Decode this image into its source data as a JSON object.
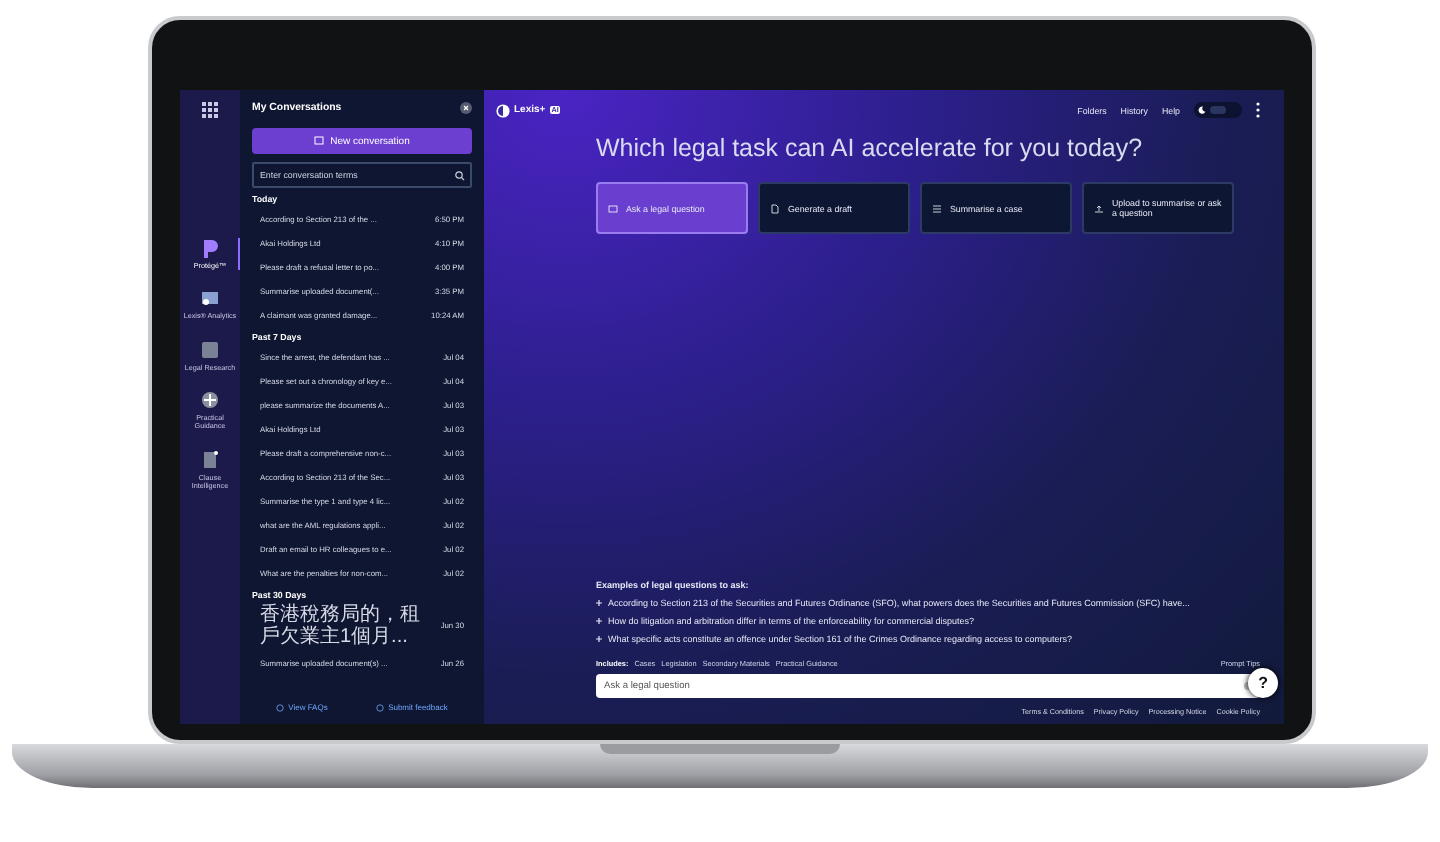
{
  "rail": [
    {
      "label": "Protégé™",
      "selected": true
    },
    {
      "label": "Lexis® Analytics",
      "selected": false
    },
    {
      "label": "Legal Research",
      "selected": false
    },
    {
      "label": "Practical Guidance",
      "selected": false
    },
    {
      "label": "Clause Intelligence",
      "selected": false
    }
  ],
  "conversations": {
    "title": "My Conversations",
    "new_button": "New conversation",
    "search_placeholder": "Enter conversation terms",
    "groups": [
      {
        "label": "Today",
        "items": [
          {
            "title": "According to Section 213 of the ...",
            "time": "6:50 PM"
          },
          {
            "title": "Akai Holdings Ltd",
            "time": "4:10 PM"
          },
          {
            "title": "Please draft a refusal letter to po...",
            "time": "4:00 PM"
          },
          {
            "title": "Summarise uploaded document(...",
            "time": "3:35 PM"
          },
          {
            "title": "A claimant was granted damage...",
            "time": "10:24 AM"
          }
        ]
      },
      {
        "label": "Past 7 Days",
        "items": [
          {
            "title": "Since the arrest, the defendant has ...",
            "time": "Jul 04"
          },
          {
            "title": "Please set out a chronology of key e...",
            "time": "Jul 04"
          },
          {
            "title": "please summarize the documents A...",
            "time": "Jul 03"
          },
          {
            "title": "Akai Holdings Ltd",
            "time": "Jul 03"
          },
          {
            "title": "Please draft a comprehensive non-c...",
            "time": "Jul 03"
          },
          {
            "title": "According to Section 213 of the Sec...",
            "time": "Jul 03"
          },
          {
            "title": "Summarise the type 1 and type 4 lic...",
            "time": "Jul 02"
          },
          {
            "title": "what are the AML regulations appli...",
            "time": "Jul 02"
          },
          {
            "title": "Draft an email to HR colleagues to e...",
            "time": "Jul 02"
          },
          {
            "title": "What are the penalties for non-com...",
            "time": "Jul 02"
          }
        ]
      },
      {
        "label": "Past 30 Days",
        "items": [
          {
            "title": "香港稅務局的，租戶欠業主1個月...",
            "time": "Jun 30"
          },
          {
            "title": "Summarise uploaded document(s) ...",
            "time": "Jun 26"
          }
        ]
      }
    ],
    "footer": [
      "View FAQs",
      "Submit feedback"
    ]
  },
  "main": {
    "logo": "Lexis+",
    "logo_badge": "AI",
    "nav": [
      "Folders",
      "History",
      "Help"
    ],
    "heading": "Which legal task can AI accelerate for you today?",
    "tasks": [
      {
        "label": "Ask a legal question",
        "selected": true
      },
      {
        "label": "Generate a draft",
        "selected": false
      },
      {
        "label": "Summarise a case",
        "selected": false
      },
      {
        "label": "Upload to summarise or ask a question",
        "selected": false
      }
    ],
    "examples_title": "Examples of legal questions to ask:",
    "examples": [
      "According to Section 213 of the Securities and Futures Ordinance (SFO), what powers does the Securities and Futures Commission (SFC) have...",
      "How do litigation and arbitration differ in terms of the enforceability for commercial disputes?",
      "What specific acts constitute an offence under Section 161 of the Crimes Ordinance regarding access to computers?"
    ],
    "includes_label": "Includes:",
    "sources": [
      "Cases",
      "Legislation",
      "Secondary Materials",
      "Practical Guidance"
    ],
    "prompt_tips": "Prompt Tips",
    "input_placeholder": "Ask a legal question",
    "help": "?",
    "footer_links": [
      "Terms & Conditions",
      "Privacy Policy",
      "Processing Notice",
      "Cookie Policy"
    ]
  }
}
